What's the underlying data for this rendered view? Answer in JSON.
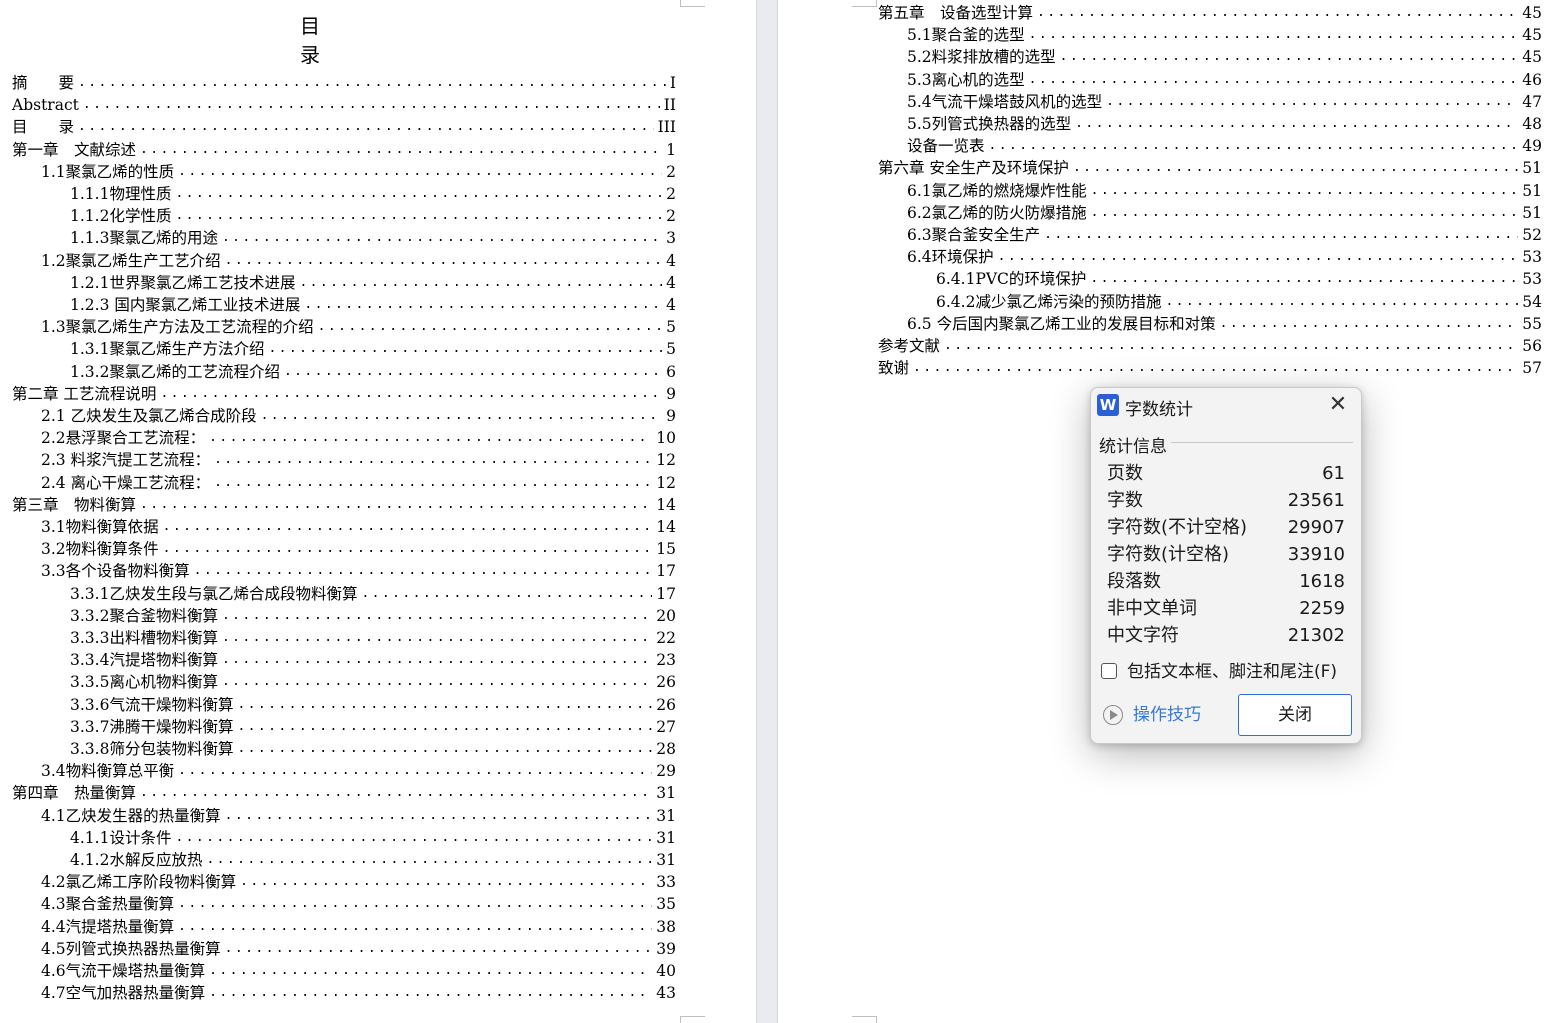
{
  "left_page": {
    "title": "目 录",
    "entries": [
      {
        "text": "摘　　要",
        "page": "I"
      },
      {
        "text": "Abstract",
        "page": "II"
      },
      {
        "text": "目　　录",
        "page": "III"
      },
      {
        "text": "第一章　文献综述",
        "page": "1"
      },
      {
        "text": "1.1聚氯乙烯的性质",
        "page": "2"
      },
      {
        "text": "1.1.1物理性质",
        "page": "2"
      },
      {
        "text": "1.1.2化学性质",
        "page": "2"
      },
      {
        "text": "1.1.3聚氯乙烯的用途",
        "page": "3"
      },
      {
        "text": "1.2聚氯乙烯生产工艺介绍",
        "page": "4"
      },
      {
        "text": "1.2.1世界聚氯乙烯工艺技术进展",
        "page": "4"
      },
      {
        "text": "1.2.3 国内聚氯乙烯工业技术进展",
        "page": "4"
      },
      {
        "text": "1.3聚氯乙烯生产方法及工艺流程的介绍",
        "page": "5"
      },
      {
        "text": "1.3.1聚氯乙烯生产方法介绍",
        "page": "5"
      },
      {
        "text": "1.3.2聚氯乙烯的工艺流程介绍",
        "page": "6"
      },
      {
        "text": "第二章 工艺流程说明",
        "page": "9"
      },
      {
        "text": "2.1 乙炔发生及氯乙烯合成阶段",
        "page": "9"
      },
      {
        "text": "2.2悬浮聚合工艺流程：",
        "page": "10"
      },
      {
        "text": "2.3 料浆汽提工艺流程：",
        "page": "12"
      },
      {
        "text": "2.4 离心干燥工艺流程：",
        "page": "12"
      },
      {
        "text": "第三章　物料衡算",
        "page": "14"
      },
      {
        "text": "3.1物料衡算依据",
        "page": "14"
      },
      {
        "text": "3.2物料衡算条件",
        "page": "15"
      },
      {
        "text": "3.3各个设备物料衡算",
        "page": "17"
      },
      {
        "text": "3.3.1乙炔发生段与氯乙烯合成段物料衡算",
        "page": "17"
      },
      {
        "text": "3.3.2聚合釜物料衡算",
        "page": "20"
      },
      {
        "text": "3.3.3出料槽物料衡算",
        "page": "22"
      },
      {
        "text": "3.3.4汽提塔物料衡算",
        "page": "23"
      },
      {
        "text": "3.3.5离心机物料衡算",
        "page": "26"
      },
      {
        "text": "3.3.6气流干燥物料衡算",
        "page": "26"
      },
      {
        "text": "3.3.7沸腾干燥物料衡算",
        "page": "27"
      },
      {
        "text": "3.3.8筛分包装物料衡算",
        "page": "28"
      },
      {
        "text": "3.4物料衡算总平衡",
        "page": "29"
      },
      {
        "text": "第四章　热量衡算",
        "page": "31"
      },
      {
        "text": "4.1乙炔发生器的热量衡算",
        "page": "31"
      },
      {
        "text": "4.1.1设计条件",
        "page": "31"
      },
      {
        "text": "4.1.2水解反应放热",
        "page": "31"
      },
      {
        "text": "4.2氯乙烯工序阶段物料衡算",
        "page": "33"
      },
      {
        "text": "4.3聚合釜热量衡算",
        "page": "35"
      },
      {
        "text": "4.4汽提塔热量衡算",
        "page": "38"
      },
      {
        "text": "4.5列管式换热器热量衡算",
        "page": "39"
      },
      {
        "text": "4.6气流干燥塔热量衡算",
        "page": "40"
      },
      {
        "text": "4.7空气加热器热量衡算",
        "page": "43"
      }
    ]
  },
  "right_page": {
    "entries": [
      {
        "text": "第五章　设备选型计算",
        "page": "45"
      },
      {
        "text": "5.1聚合釜的选型",
        "page": "45"
      },
      {
        "text": "5.2料浆排放槽的选型",
        "page": "45"
      },
      {
        "text": "5.3离心机的选型",
        "page": "46"
      },
      {
        "text": "5.4气流干燥塔鼓风机的选型",
        "page": "47"
      },
      {
        "text": "5.5列管式换热器的选型",
        "page": "48"
      },
      {
        "text": "设备一览表",
        "page": "49"
      },
      {
        "text": "第六章 安全生产及环境保护",
        "page": "51"
      },
      {
        "text": "6.1氯乙烯的燃烧爆炸性能",
        "page": "51"
      },
      {
        "text": "6.2氯乙烯的防火防爆措施",
        "page": "51"
      },
      {
        "text": "6.3聚合釜安全生产",
        "page": "52"
      },
      {
        "text": "6.4环境保护",
        "page": "53"
      },
      {
        "text": "6.4.1PVC的环境保护",
        "page": "53"
      },
      {
        "text": "6.4.2减少氯乙烯污染的预防措施",
        "page": "54"
      },
      {
        "text": "6.5 今后国内聚氯乙烯工业的发展目标和对策",
        "page": "55"
      },
      {
        "text": "参考文献",
        "page": "56"
      },
      {
        "text": "致谢",
        "page": "57"
      }
    ]
  },
  "dialog": {
    "title": "字数统计",
    "app_icon_letter": "W",
    "app_icon_color": "#2a5fd8",
    "group_label": "统计信息",
    "stats": [
      {
        "label": "页数",
        "value": "61"
      },
      {
        "label": "字数",
        "value": "23561"
      },
      {
        "label": "字符数(不计空格)",
        "value": "29907"
      },
      {
        "label": "字符数(计空格)",
        "value": "33910"
      },
      {
        "label": "段落数",
        "value": "1618"
      },
      {
        "label": "非中文单词",
        "value": "2259"
      },
      {
        "label": "中文字符",
        "value": "21302"
      }
    ],
    "checkbox_label": "包括文本框、脚注和尾注(F)",
    "checkbox_checked": false,
    "tips_label": "操作技巧",
    "close_button_label": "关闭",
    "accent_color": "#2f6fd4"
  }
}
